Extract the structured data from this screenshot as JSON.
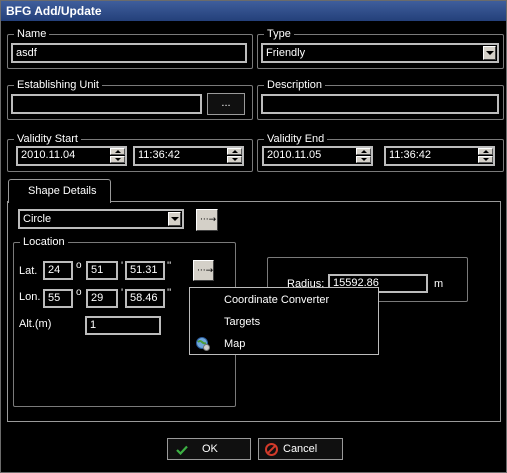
{
  "window": {
    "title": "BFG Add/Update"
  },
  "name": {
    "label": "Name",
    "value": "asdf"
  },
  "type": {
    "label": "Type",
    "value": "Friendly"
  },
  "establishing_unit": {
    "label": "Establishing Unit",
    "value": "",
    "browse_label": "..."
  },
  "description": {
    "label": "Description",
    "value": ""
  },
  "validity_start": {
    "label": "Validity Start",
    "date": "2010.11.04",
    "time": "11:36:42"
  },
  "validity_end": {
    "label": "Validity End",
    "date": "2010.11.05",
    "time": "11:36:42"
  },
  "shape_details": {
    "tab_label": "Shape Details",
    "shape": "Circle",
    "location": {
      "label": "Location",
      "lat_label": "Lat.",
      "lat": {
        "deg": "24",
        "min": "51",
        "sec": "51.31"
      },
      "lon_label": "Lon.",
      "lon": {
        "deg": "55",
        "min": "29",
        "sec": "58.46"
      },
      "deg_symbol": "o",
      "min_symbol": "'",
      "sec_symbol": "''",
      "alt_label": "Alt.(m)",
      "alt": "1"
    },
    "radius": {
      "label": "Radius:",
      "value": "15592.86",
      "unit": "m"
    }
  },
  "context_menu": {
    "items": [
      {
        "label": "Coordinate Converter",
        "icon": ""
      },
      {
        "label": "Targets",
        "icon": ""
      },
      {
        "label": "Map",
        "icon": "globe-icon"
      }
    ]
  },
  "buttons": {
    "ok": "OK",
    "cancel": "Cancel"
  },
  "colors": {
    "title_bar": "#2e4c8a",
    "ok_check": "#3cb043",
    "cancel_icon": "#d23a2a"
  }
}
